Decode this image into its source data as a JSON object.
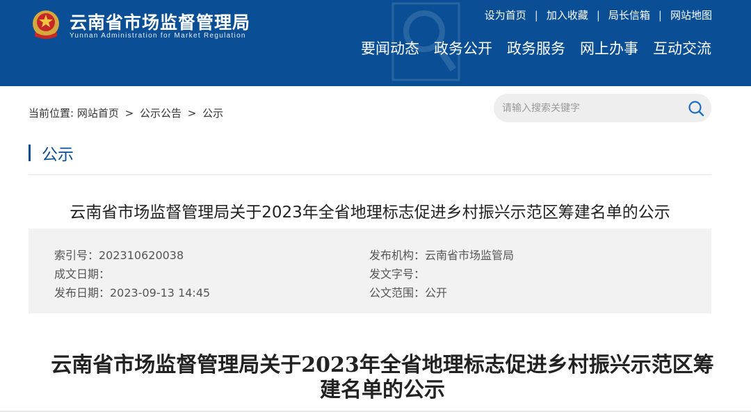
{
  "header": {
    "logo_cn": "云南省市场监督管理局",
    "logo_en": "Yunnan Administration for Market Regulation",
    "toplinks": [
      "设为首页",
      "加入收藏",
      "局长信箱",
      "网站地图"
    ],
    "toplink_sep": "|",
    "nav": [
      "要闻动态",
      "政务公开",
      "政务服务",
      "网上办事",
      "互动交流"
    ]
  },
  "breadcrumb": {
    "prefix": "当前位置:",
    "items": [
      "网站首页",
      "公示公告",
      "公示"
    ],
    "sep": ">"
  },
  "search": {
    "placeholder": "请输入搜索关键字",
    "icon": "search-icon"
  },
  "section": {
    "title": "公示"
  },
  "article": {
    "title": "云南省市场监督管理局关于2023年全省地理标志促进乡村振兴示范区筹建名单的公示",
    "meta": {
      "index_no": "索引号：202310620038",
      "publisher": "发布机构：云南省市场监管局",
      "created": "成文日期：",
      "doc_no": "发文字号：",
      "pub_date": "发布日期：2023-09-13 14:45",
      "scope": "公文范围：公开"
    },
    "doc_title_line1": "云南省市场监督管理局关于2023年全省地理标志促进乡村振兴示范区筹",
    "doc_title_line2": "建名单的公示"
  },
  "colors": {
    "header_bg": "#0a4f96",
    "accent": "#0a4f96",
    "meta_bg": "#f2f2f2"
  }
}
